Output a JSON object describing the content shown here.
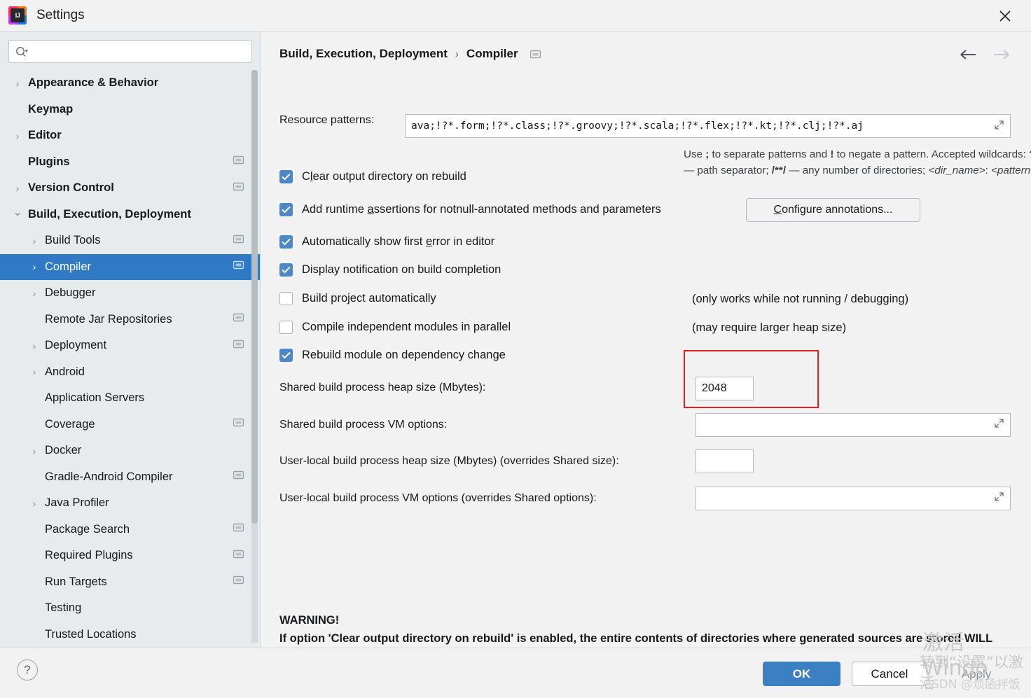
{
  "window": {
    "title": "Settings",
    "logo_text": "IJ",
    "close_icon": "close-icon"
  },
  "sidebar": {
    "search": {
      "placeholder": "",
      "value": "",
      "icon": "search-icon"
    },
    "items": [
      {
        "label": "Appearance & Behavior",
        "level": 0,
        "chevron": "›",
        "settings_icon": false,
        "selected": false
      },
      {
        "label": "Keymap",
        "level": 0,
        "chevron": "",
        "settings_icon": false,
        "selected": false
      },
      {
        "label": "Editor",
        "level": 0,
        "chevron": "›",
        "settings_icon": false,
        "selected": false
      },
      {
        "label": "Plugins",
        "level": 0,
        "chevron": "",
        "settings_icon": true,
        "selected": false
      },
      {
        "label": "Version Control",
        "level": 0,
        "chevron": "›",
        "settings_icon": true,
        "selected": false
      },
      {
        "label": "Build, Execution, Deployment",
        "level": 0,
        "chevron": "⌄",
        "settings_icon": false,
        "selected": false
      },
      {
        "label": "Build Tools",
        "level": 1,
        "chevron": "›",
        "settings_icon": true,
        "selected": false
      },
      {
        "label": "Compiler",
        "level": 1,
        "chevron": "›",
        "settings_icon": true,
        "selected": true
      },
      {
        "label": "Debugger",
        "level": 1,
        "chevron": "›",
        "settings_icon": false,
        "selected": false
      },
      {
        "label": "Remote Jar Repositories",
        "level": 1,
        "chevron": "",
        "settings_icon": true,
        "selected": false
      },
      {
        "label": "Deployment",
        "level": 1,
        "chevron": "›",
        "settings_icon": true,
        "selected": false
      },
      {
        "label": "Android",
        "level": 1,
        "chevron": "›",
        "settings_icon": false,
        "selected": false
      },
      {
        "label": "Application Servers",
        "level": 1,
        "chevron": "",
        "settings_icon": false,
        "selected": false
      },
      {
        "label": "Coverage",
        "level": 1,
        "chevron": "",
        "settings_icon": true,
        "selected": false
      },
      {
        "label": "Docker",
        "level": 1,
        "chevron": "›",
        "settings_icon": false,
        "selected": false
      },
      {
        "label": "Gradle-Android Compiler",
        "level": 1,
        "chevron": "",
        "settings_icon": true,
        "selected": false
      },
      {
        "label": "Java Profiler",
        "level": 1,
        "chevron": "›",
        "settings_icon": false,
        "selected": false
      },
      {
        "label": "Package Search",
        "level": 1,
        "chevron": "",
        "settings_icon": true,
        "selected": false
      },
      {
        "label": "Required Plugins",
        "level": 1,
        "chevron": "",
        "settings_icon": true,
        "selected": false
      },
      {
        "label": "Run Targets",
        "level": 1,
        "chevron": "",
        "settings_icon": true,
        "selected": false
      },
      {
        "label": "Testing",
        "level": 1,
        "chevron": "",
        "settings_icon": false,
        "selected": false
      },
      {
        "label": "Trusted Locations",
        "level": 1,
        "chevron": "",
        "settings_icon": false,
        "selected": false
      }
    ]
  },
  "main": {
    "breadcrumb": {
      "parent": "Build, Execution, Deployment",
      "separator": "›",
      "current": "Compiler"
    },
    "nav": {
      "back_icon": "arrow-left-icon",
      "forward_icon": "arrow-right-icon"
    },
    "resource_patterns": {
      "label": "Resource patterns:",
      "value": "ava;!?*.form;!?*.class;!?*.groovy;!?*.scala;!?*.flex;!?*.kt;!?*.clj;!?*.aj",
      "expand_icon": "expand-icon"
    },
    "hint_text": "Use ; to separate patterns and ! to negate a pattern. Accepted wildcards: ? — exactly one symbol; * — zero or more symbols; / — path separator; /**/ — any number of directories; <dir_name>: <pattern> — restrict to source roots with the specified name",
    "checkboxes": [
      {
        "label_pre": "C",
        "mnemonic": "l",
        "label_post": "ear output directory on rebuild",
        "checked": true
      },
      {
        "label_pre": "Add runtime ",
        "mnemonic": "a",
        "label_post": "ssertions for notnull-annotated methods and parameters",
        "checked": true
      },
      {
        "label_pre": "Automatically show first ",
        "mnemonic": "e",
        "label_post": "rror in editor",
        "checked": true
      },
      {
        "label_pre": "Display notification on build completion",
        "mnemonic": "",
        "label_post": "",
        "checked": true
      },
      {
        "label_pre": "Build project automatically",
        "mnemonic": "",
        "label_post": "",
        "checked": false
      },
      {
        "label_pre": "Compile independent modules in parallel",
        "mnemonic": "",
        "label_post": "",
        "checked": false
      },
      {
        "label_pre": "Rebuild module on dependency change",
        "mnemonic": "",
        "label_post": "",
        "checked": true
      }
    ],
    "configure_annotations": {
      "pre": "",
      "mnemonic": "C",
      "post": "onfigure annotations..."
    },
    "notes": {
      "build_auto": "(only works while not running / debugging)",
      "parallel": "(may require larger heap size)"
    },
    "fields": [
      {
        "label": "Shared build process heap size (Mbytes):",
        "value": "2048",
        "expandable": false
      },
      {
        "label": "Shared build process VM options:",
        "value": "",
        "expandable": true
      },
      {
        "label": "User-local build process heap size (Mbytes) (overrides Shared size):",
        "value": "",
        "expandable": false
      },
      {
        "label": "User-local build process VM options (overrides Shared options):",
        "value": "",
        "expandable": true
      }
    ],
    "warning": {
      "title": "WARNING!",
      "body": "If option 'Clear output directory on rebuild' is enabled, the entire contents of directories where generated sources are stored WILL BE CLEARED on rebuild."
    },
    "annotation_color": "#e02020"
  },
  "footer": {
    "help_icon": "?",
    "ok_label": "OK",
    "cancel_label": "Cancel",
    "apply_label": "Apply"
  },
  "watermark": {
    "line1": "激活 Windo",
    "line2": "转到“设置”以激活",
    "csdn": "CSDN @烦函拌饭"
  }
}
